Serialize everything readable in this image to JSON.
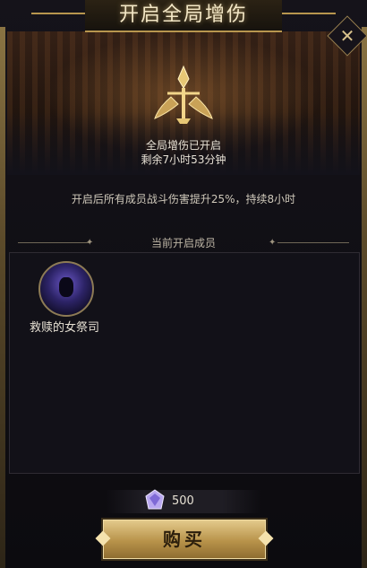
{
  "dialog": {
    "title": "开启全局增伤",
    "close_icon": "close-icon"
  },
  "status": {
    "active_text": "全局增伤已开启",
    "remaining_text": "剩余7小时53分钟"
  },
  "description": "开启后所有成员战斗伤害提升25%，持续8小时",
  "members_section": {
    "label": "当前开启成员",
    "members": [
      {
        "name": "救赎的女祭司",
        "avatar_icon": "hooded-priestess-avatar"
      }
    ]
  },
  "price": {
    "icon": "gem-icon",
    "value": "500"
  },
  "buy_button": {
    "label": "购买"
  },
  "colors": {
    "gold": "#b8964e",
    "button_gold": "#d6b66f",
    "panel_bg": "#121118"
  }
}
